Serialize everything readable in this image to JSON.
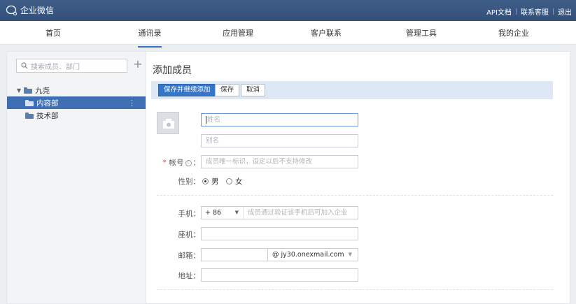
{
  "header": {
    "app_name": "企业微信",
    "links": [
      "API文档",
      "联系客服",
      "退出"
    ]
  },
  "nav": {
    "tabs": [
      "首页",
      "通讯录",
      "应用管理",
      "客户联系",
      "管理工具",
      "我的企业"
    ],
    "active_index": 1
  },
  "sidebar": {
    "search_placeholder": "搜索成员、部门",
    "add_label": "+",
    "tree": {
      "root": "九尧",
      "children": [
        "内容部",
        "技术部"
      ],
      "selected": "内容部"
    }
  },
  "main": {
    "title": "添加成员",
    "actions": {
      "save_continue": "保存并继续添加",
      "save": "保存",
      "cancel": "取消"
    },
    "form": {
      "name_placeholder": "姓名",
      "alias_placeholder": "别名",
      "account_label": "帐号",
      "account_required_mark": "*",
      "account_placeholder": "成员唯一标识，设定以后不支持修改",
      "gender_label": "性别：",
      "gender_options": [
        "男",
        "女"
      ],
      "gender_selected": "男",
      "mobile_label": "手机：",
      "mobile_prefix": "+ 86",
      "mobile_placeholder": "成员通过验证该手机后可加入企业",
      "landline_label": "座机：",
      "email_label": "邮箱：",
      "email_domain": "@ jy30.onexmail.com",
      "address_label": "地址："
    }
  },
  "colors": {
    "topbar": "#3e5d87",
    "primary": "#3576c7",
    "selected_row": "#3e6fb4",
    "action_bar": "#dde8f4"
  }
}
